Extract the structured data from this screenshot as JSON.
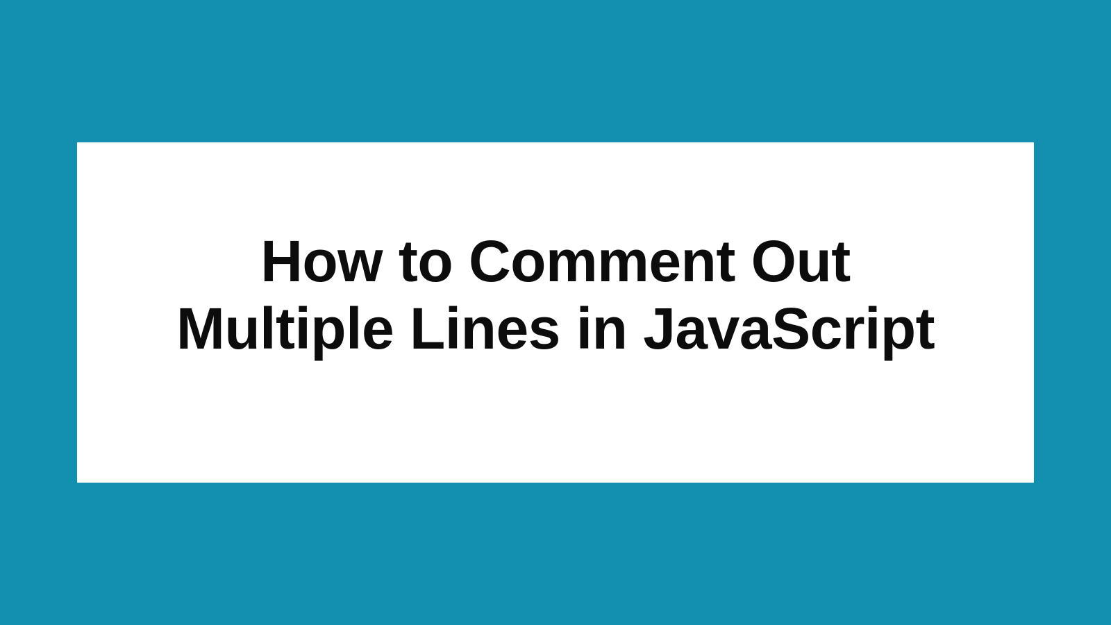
{
  "card": {
    "title": "How to Comment Out Multiple Lines in JavaScript"
  },
  "colors": {
    "background": "#1390af",
    "card_background": "#ffffff",
    "text": "#0c0c0c"
  }
}
